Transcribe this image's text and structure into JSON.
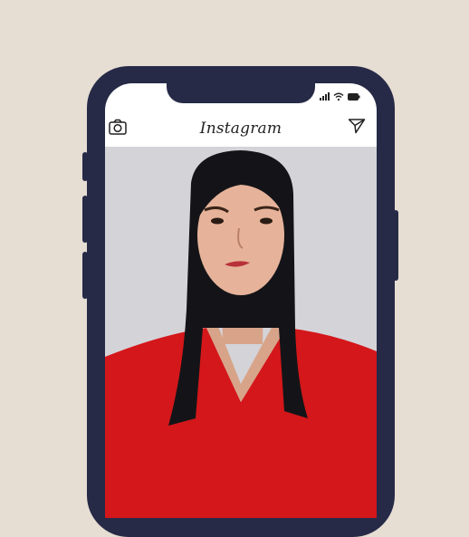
{
  "app": {
    "logo_text": "Instagram",
    "header_icons": [
      "camera-icon",
      "send-icon"
    ],
    "status_icons": [
      "signal-icon",
      "wifi-icon",
      "battery-icon"
    ]
  },
  "post": {
    "image_subject": "photo-post",
    "colors": {
      "background": "#e6ddd3",
      "phone_frame": "#262a47",
      "shirt": "#d4171a",
      "hair": "#141418",
      "backdrop": "#d4d3d8"
    }
  }
}
